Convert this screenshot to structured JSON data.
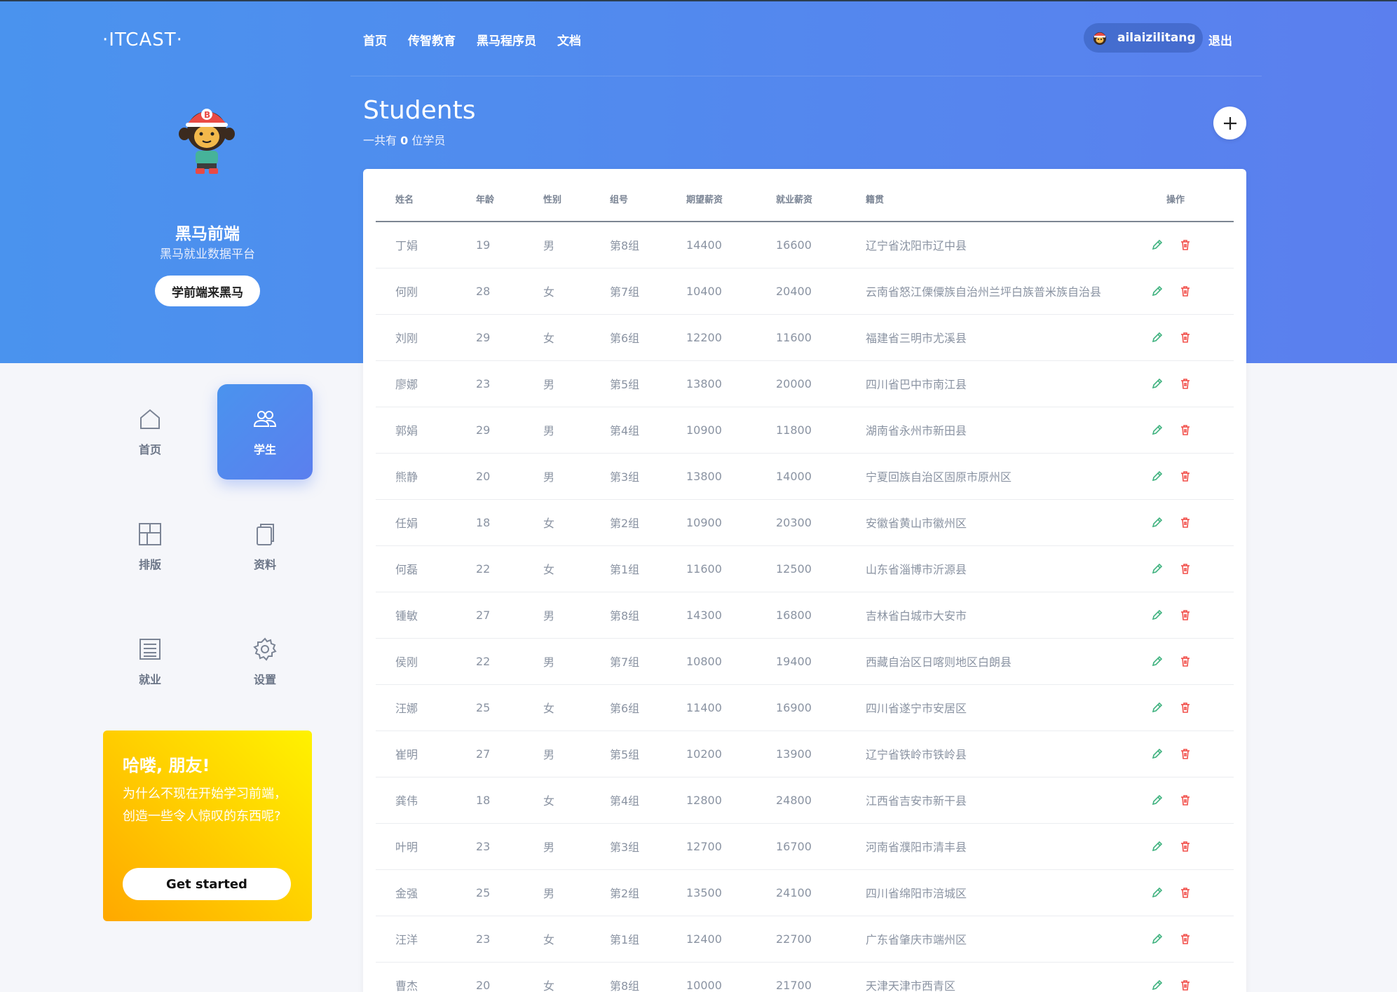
{
  "header": {
    "logo": "·ITCAST·",
    "nav": [
      "首页",
      "传智教育",
      "黑马程序员",
      "文档"
    ],
    "username": "ailaizilitang",
    "logout": "退出"
  },
  "brand": {
    "title": "黑马前端",
    "subtitle": "黑马就业数据平台",
    "button": "学前端来黑马"
  },
  "sidebar": {
    "items": [
      {
        "label": "首页",
        "icon": "home-icon",
        "active": false
      },
      {
        "label": "学生",
        "icon": "users-icon",
        "active": true
      },
      {
        "label": "排版",
        "icon": "layout-icon",
        "active": false
      },
      {
        "label": "资料",
        "icon": "copy-icon",
        "active": false
      },
      {
        "label": "就业",
        "icon": "list-icon",
        "active": false
      },
      {
        "label": "设置",
        "icon": "gear-icon",
        "active": false
      }
    ]
  },
  "promo": {
    "heading": "哈喽, 朋友!",
    "text": "为什么不现在开始学习前端，创造一些令人惊叹的东西呢?",
    "button": "Get started"
  },
  "main": {
    "title": "Students",
    "count_prefix": "一共有",
    "count": "0",
    "count_suffix": "位学员"
  },
  "table": {
    "headers": [
      "姓名",
      "年龄",
      "性别",
      "组号",
      "期望薪资",
      "就业薪资",
      "籍贯",
      "操作"
    ],
    "rows": [
      [
        "丁娟",
        "19",
        "男",
        "第8组",
        "14400",
        "16600",
        "辽宁省沈阳市辽中县"
      ],
      [
        "何刚",
        "28",
        "女",
        "第7组",
        "10400",
        "20400",
        "云南省怒江傈僳族自治州兰坪白族普米族自治县"
      ],
      [
        "刘刚",
        "29",
        "女",
        "第6组",
        "12200",
        "11600",
        "福建省三明市尤溪县"
      ],
      [
        "廖娜",
        "23",
        "男",
        "第5组",
        "13800",
        "20000",
        "四川省巴中市南江县"
      ],
      [
        "郭娟",
        "29",
        "男",
        "第4组",
        "10900",
        "11800",
        "湖南省永州市新田县"
      ],
      [
        "熊静",
        "20",
        "男",
        "第3组",
        "13800",
        "14000",
        "宁夏回族自治区固原市原州区"
      ],
      [
        "任娟",
        "18",
        "女",
        "第2组",
        "10900",
        "20300",
        "安徽省黄山市徽州区"
      ],
      [
        "何磊",
        "22",
        "女",
        "第1组",
        "11600",
        "12500",
        "山东省淄博市沂源县"
      ],
      [
        "锺敏",
        "27",
        "男",
        "第8组",
        "14300",
        "16800",
        "吉林省白城市大安市"
      ],
      [
        "侯刚",
        "22",
        "男",
        "第7组",
        "10800",
        "19400",
        "西藏自治区日喀则地区白朗县"
      ],
      [
        "汪娜",
        "25",
        "女",
        "第6组",
        "11400",
        "16900",
        "四川省遂宁市安居区"
      ],
      [
        "崔明",
        "27",
        "男",
        "第5组",
        "10200",
        "13900",
        "辽宁省铁岭市铁岭县"
      ],
      [
        "龚伟",
        "18",
        "女",
        "第4组",
        "12800",
        "24800",
        "江西省吉安市新干县"
      ],
      [
        "叶明",
        "23",
        "男",
        "第3组",
        "12700",
        "16700",
        "河南省濮阳市清丰县"
      ],
      [
        "金强",
        "25",
        "男",
        "第2组",
        "13500",
        "24100",
        "四川省绵阳市涪城区"
      ],
      [
        "汪洋",
        "23",
        "女",
        "第1组",
        "12400",
        "22700",
        "广东省肇庆市端州区"
      ],
      [
        "曹杰",
        "20",
        "女",
        "第8组",
        "10000",
        "21700",
        "天津天津市西青区"
      ]
    ]
  },
  "colors": {
    "banner_start": "#4a93ee",
    "banner_end": "#5b7fee",
    "edit": "#3fb27f",
    "delete": "#f2504b"
  }
}
